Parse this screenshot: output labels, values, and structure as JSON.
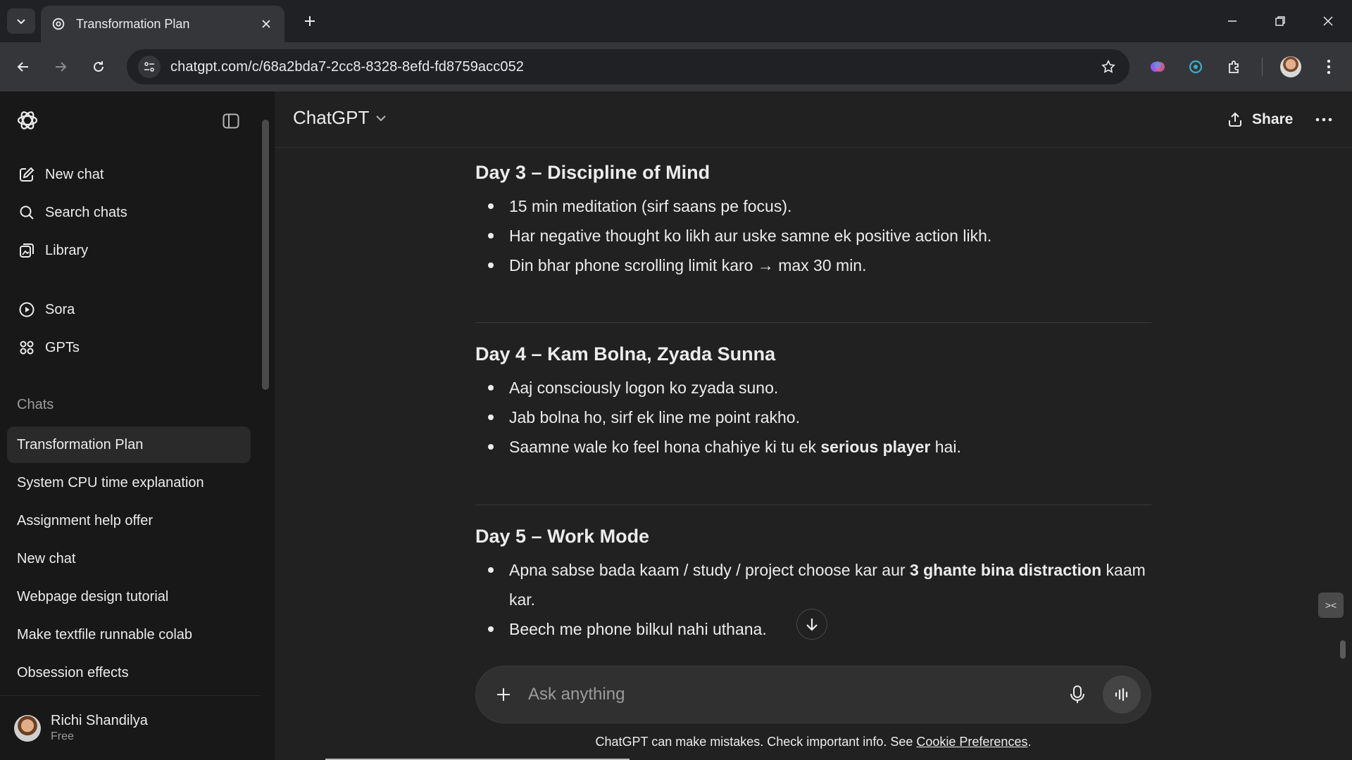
{
  "browser": {
    "tab_title": "Transformation Plan",
    "url": "chatgpt.com/c/68a2bda7-2cc8-8328-8efd-fd8759acc052"
  },
  "sidebar": {
    "nav": [
      {
        "label": "New chat",
        "icon": "edit-icon"
      },
      {
        "label": "Search chats",
        "icon": "search-icon"
      },
      {
        "label": "Library",
        "icon": "library-icon"
      },
      {
        "label": "Sora",
        "icon": "play-icon"
      },
      {
        "label": "GPTs",
        "icon": "grid-icon"
      }
    ],
    "section_label": "Chats",
    "chats": [
      "Transformation Plan",
      "System CPU time explanation",
      "Assignment help offer",
      "New chat",
      "Webpage design tutorial",
      "Make textfile runnable colab",
      "Obsession effects"
    ],
    "user": {
      "name": "Richi Shandilya",
      "plan": "Free"
    }
  },
  "header": {
    "model": "ChatGPT",
    "share_label": "Share"
  },
  "content": {
    "days": [
      {
        "title": "Day 3 – Discipline of Mind",
        "bullets": [
          [
            "15 min meditation (sirf saans pe focus)."
          ],
          [
            "Har negative thought ko likh aur uske samne ek positive action likh."
          ],
          [
            "Din bhar phone scrolling limit karo → max 30 min."
          ]
        ]
      },
      {
        "title": "Day 4 – Kam Bolna, Zyada Sunna",
        "bullets": [
          [
            "Aaj consciously logon ko zyada suno."
          ],
          [
            "Jab bolna ho, sirf ek line me point rakho."
          ],
          [
            "Saamne wale ko feel hona chahiye ki tu ek ",
            "serious player",
            " hai."
          ]
        ]
      },
      {
        "title": "Day 5 – Work Mode",
        "bullets": [
          [
            "Apna sabse bada kaam / study / project choose kar aur ",
            "3 ghante bina distraction",
            " kaam kar."
          ],
          [
            "Beech me phone bilkul nahi uthana."
          ]
        ]
      }
    ]
  },
  "composer": {
    "placeholder": "Ask anything"
  },
  "footer": {
    "disclaimer": "ChatGPT can make mistakes. Check important info. See ",
    "link": "Cookie Preferences",
    "end": "."
  },
  "colors": {
    "sidebar_bg": "#181818",
    "main_bg": "#212121",
    "active_chat": "#2a2a2a",
    "composer_bg": "#303030"
  }
}
